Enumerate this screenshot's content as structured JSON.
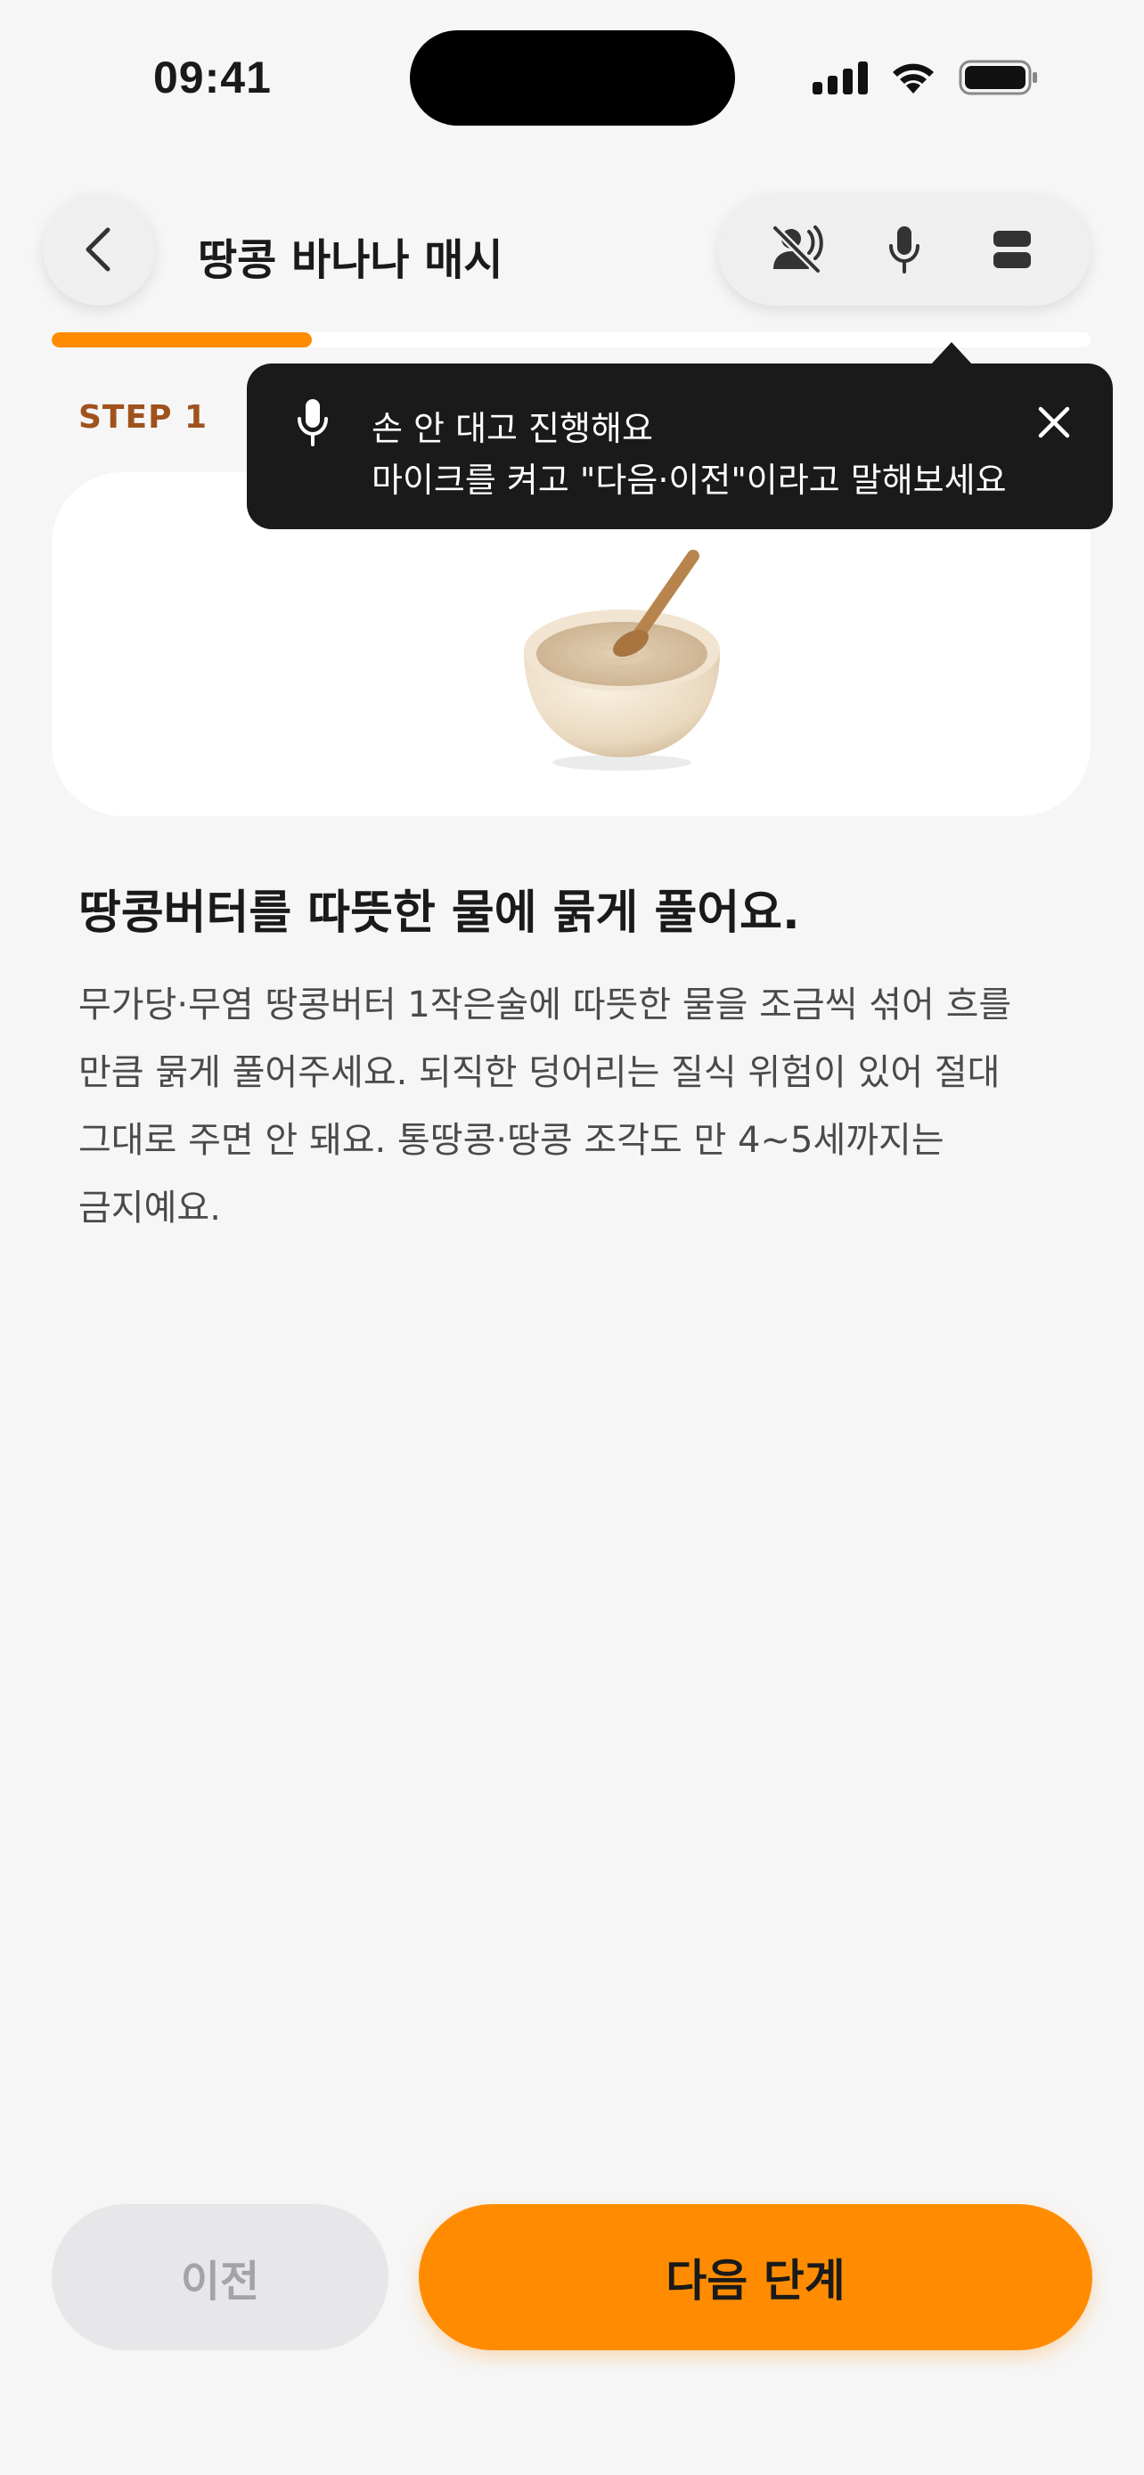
{
  "status_bar": {
    "time": "09:41",
    "icons": [
      "cellular-signal-icon",
      "wifi-icon",
      "battery-icon"
    ]
  },
  "header": {
    "back_icon": "chevron-left-icon",
    "title": "땅콩 바나나 매시",
    "tools": [
      "voice-off-icon",
      "microphone-icon",
      "layout-toggle-icon"
    ]
  },
  "progress": {
    "current_step": 1,
    "fraction": 0.25
  },
  "step": {
    "label": "STEP 1",
    "image_icon": "porridge-bowl-icon",
    "title": "땅콩버터를 따뜻한 물에 묽게 풀어요.",
    "description": "무가당·무염 땅콩버터 1작은술에 따뜻한 물을 조금씩 섞어 흐를 만큼 묽게 풀어주세요. 되직한 덩어리는 질식 위험이 있어 절대 그대로 주면 안 돼요. 통땅콩·땅콩 조각도 만 4~5세까지는 금지예요."
  },
  "tooltip": {
    "icon": "microphone-icon",
    "title": "손 안 대고 진행해요",
    "subtitle": "마이크를 켜고 \"다음·이전\"이라고 말해보세요",
    "close_icon": "close-icon"
  },
  "buttons": {
    "prev_label": "이전",
    "next_label": "다음 단계"
  },
  "colors": {
    "accent": "#FF8C00",
    "step_label": "#A0521C",
    "background": "#F6F6F6",
    "tooltip_bg": "#1A1A1A"
  }
}
